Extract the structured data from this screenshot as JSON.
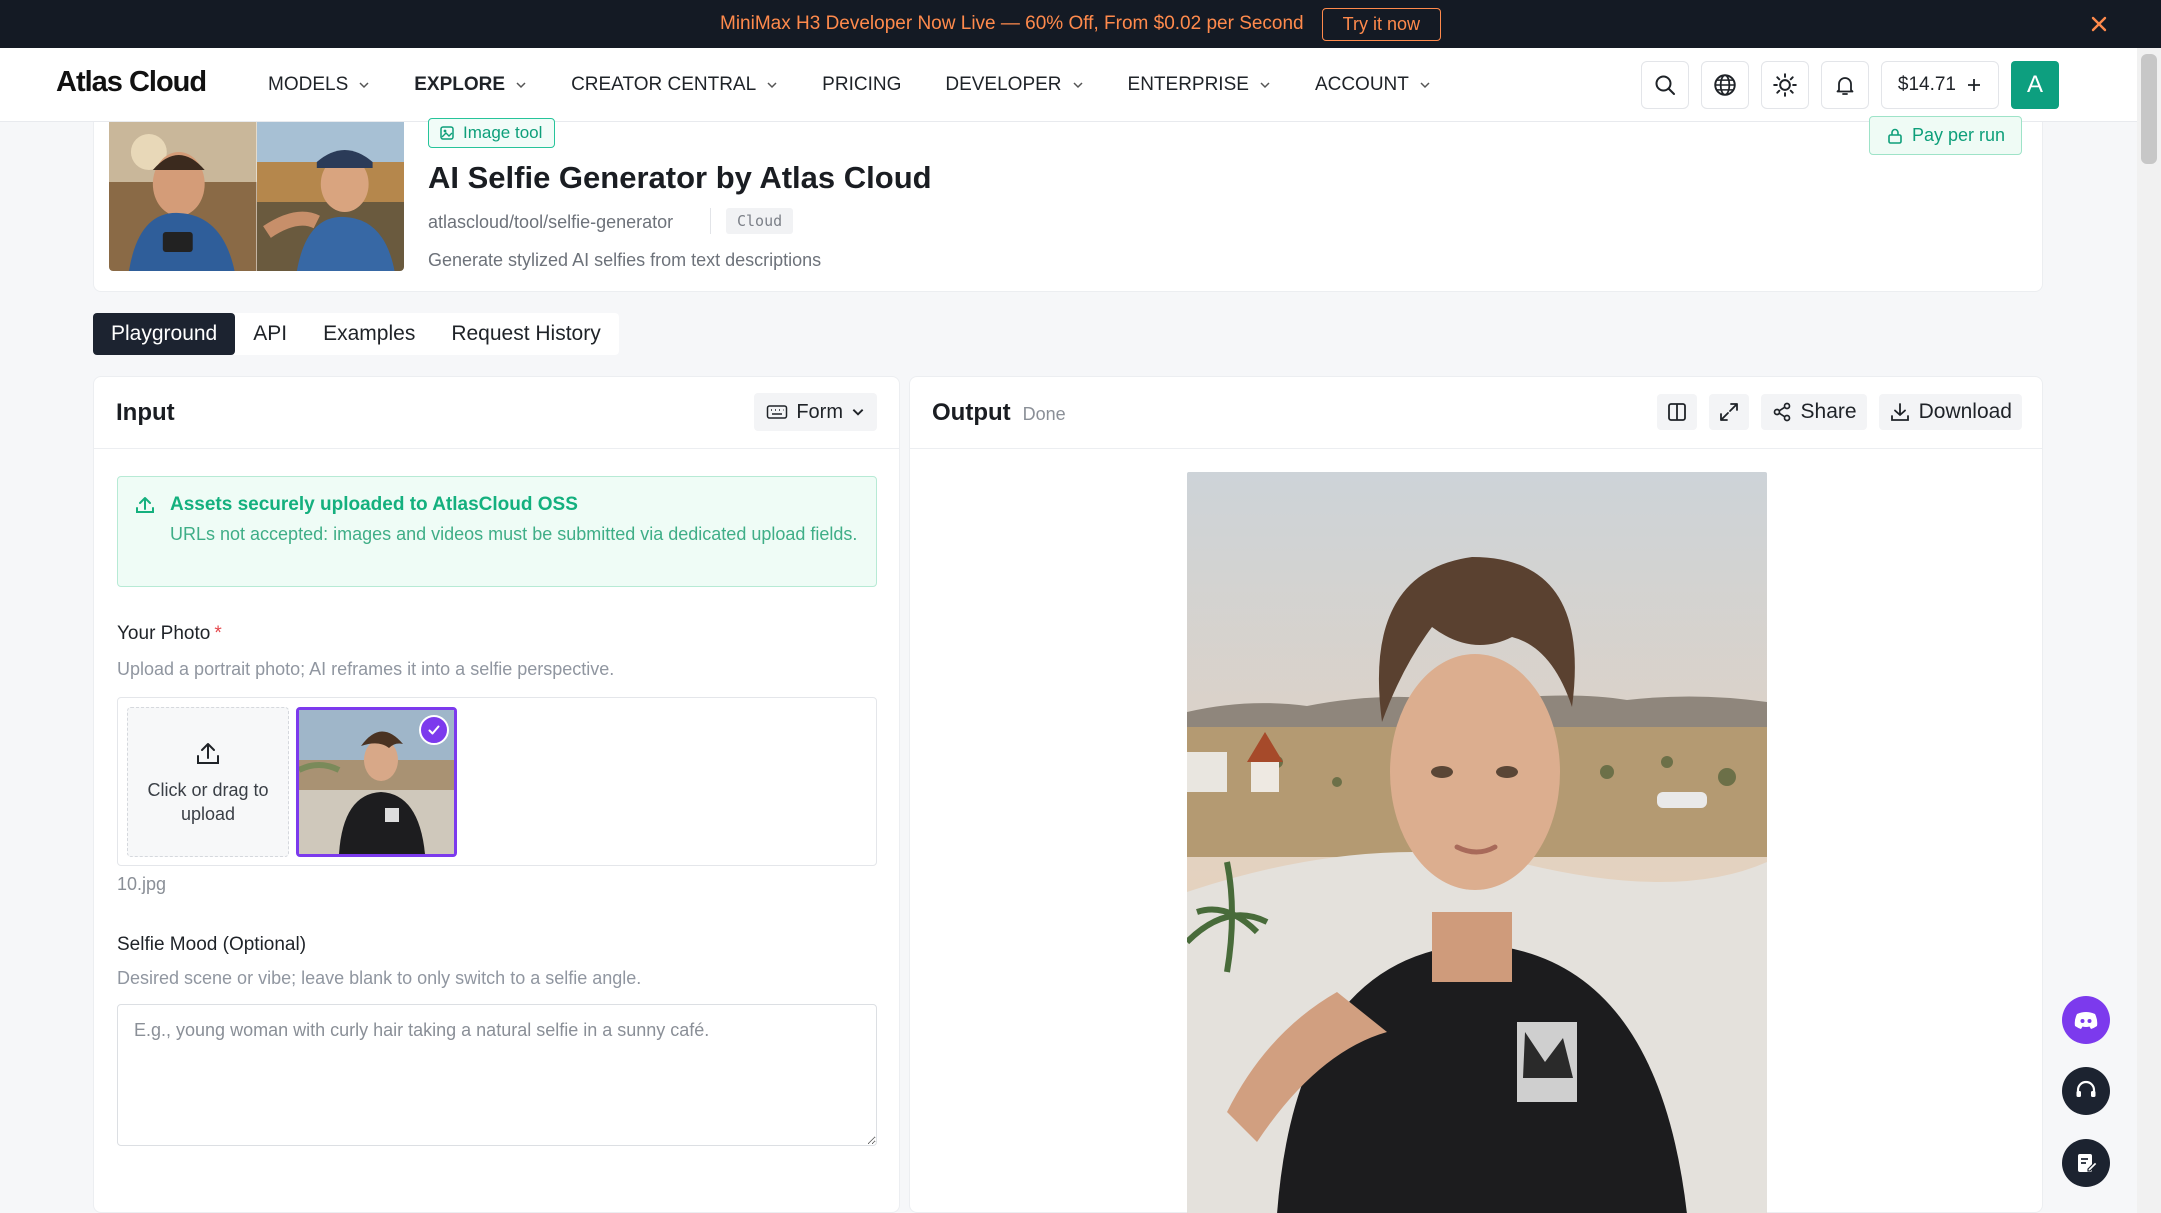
{
  "promo": {
    "text": "MiniMax H3 Developer Now Live — 60% Off, From $0.02 per Second",
    "cta": "Try it now"
  },
  "nav": {
    "logo": "Atlas Cloud",
    "menu": [
      "MODELS",
      "EXPLORE",
      "CREATOR CENTRAL",
      "PRICING",
      "DEVELOPER",
      "ENTERPRISE",
      "ACCOUNT"
    ],
    "active_menu": "EXPLORE",
    "balance": "$14.71",
    "avatar_initial": "A"
  },
  "model": {
    "badge": "Image tool",
    "title": "AI Selfie Generator by Atlas Cloud",
    "id": "atlascloud/tool/selfie-generator",
    "tag": "Cloud",
    "description": "Generate stylized AI selfies from text descriptions",
    "pricing": "Pay per run"
  },
  "tabs": [
    "Playground",
    "API",
    "Examples",
    "Request History"
  ],
  "input": {
    "title": "Input",
    "mode": "Form",
    "notice_title": "Assets securely uploaded to AtlasCloud OSS",
    "notice_body": "URLs not accepted: images and videos must be submitted via dedicated upload fields.",
    "photo_label": "Your Photo",
    "photo_required": "*",
    "photo_hint": "Upload a portrait photo; AI reframes it into a selfie perspective.",
    "upload_text": "Click or drag to upload",
    "file_name": "10.jpg",
    "mood_label": "Selfie Mood (Optional)",
    "mood_hint": "Desired scene or vibe; leave blank to only switch to a selfie angle.",
    "mood_placeholder": "E.g., young woman with curly hair taking a natural selfie in a sunny café.",
    "mood_value": ""
  },
  "output": {
    "title": "Output",
    "status": "Done",
    "share_label": "Share",
    "download_label": "Download"
  },
  "colors": {
    "accent": "#0d9f7f",
    "promo_text": "#ff8a4c",
    "selected_border": "#7c3aed",
    "discord": "#7c3aed",
    "dark": "#1c2330"
  }
}
